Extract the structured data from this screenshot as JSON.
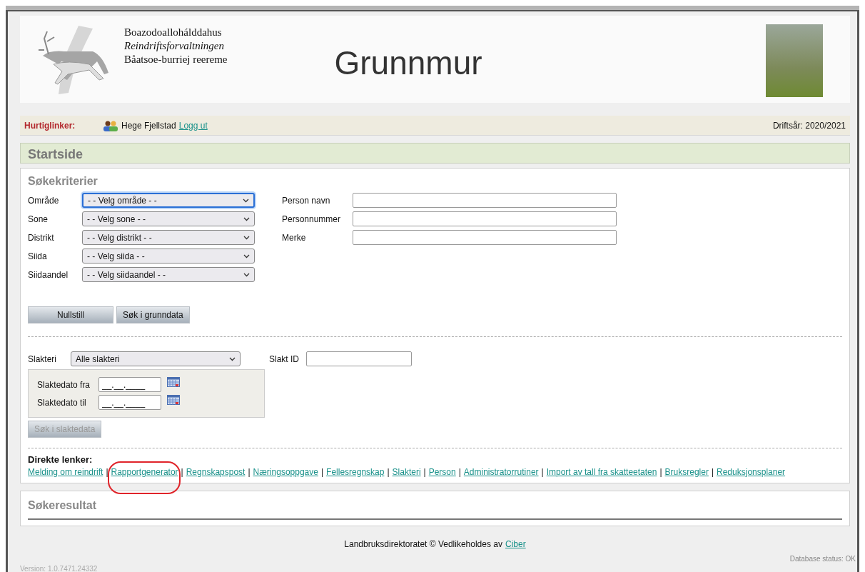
{
  "header": {
    "org_lines": [
      {
        "text": "Boazodoallohálddahus",
        "italic": false
      },
      {
        "text": "Reindriftsforvaltningen",
        "italic": true
      },
      {
        "text": "Båatsoe-burriej reereme",
        "italic": false
      }
    ],
    "title": "Grunnmur"
  },
  "quicklinks": {
    "label": "Hurtiglinker:",
    "user": "Hege Fjellstad",
    "logout": "Logg ut",
    "year": "Driftsår: 2020/2021"
  },
  "page_title": "Startside",
  "search": {
    "title": "Søkekriterier",
    "selects": [
      {
        "label": "Område",
        "value": "- - Velg område - -",
        "focused": true
      },
      {
        "label": "Sone",
        "value": "- - Velg sone - -",
        "focused": false
      },
      {
        "label": "Distrikt",
        "value": "- - Velg distrikt - -",
        "focused": false
      },
      {
        "label": "Siida",
        "value": "- - Velg siida - -",
        "focused": false
      },
      {
        "label": "Siidaandel",
        "value": "- - Velg siidaandel - -",
        "focused": false
      }
    ],
    "text_fields": [
      {
        "label": "Person navn"
      },
      {
        "label": "Personnummer"
      },
      {
        "label": "Merke"
      }
    ],
    "buttons": [
      {
        "label": "Nullstill"
      },
      {
        "label": "Søk i grunndata"
      }
    ]
  },
  "slakt": {
    "select": {
      "label": "Slakteri",
      "value": "Alle slakteri"
    },
    "id_field": {
      "label": "Slakt ID"
    },
    "dates": [
      {
        "label": "Slaktedato fra",
        "value": "__.__.____"
      },
      {
        "label": "Slaktedato til",
        "value": "__.__.____"
      }
    ],
    "button": {
      "label": "Søk i slaktedata",
      "disabled": true
    }
  },
  "direct_links": {
    "label": "Direkte lenker:",
    "separator": "|",
    "links": [
      {
        "label": "Melding om reindrift",
        "highlighted": false
      },
      {
        "label": "Rapportgenerator",
        "highlighted": true
      },
      {
        "label": "Regnskapspost",
        "highlighted": false
      },
      {
        "label": "Næringsoppgave",
        "highlighted": false
      },
      {
        "label": "Fellesregnskap",
        "highlighted": false
      },
      {
        "label": "Slakteri",
        "highlighted": false
      },
      {
        "label": "Person",
        "highlighted": false
      },
      {
        "label": "Administratorrutiner",
        "highlighted": false
      },
      {
        "label": "Import av tall fra skatteetaten",
        "highlighted": false
      },
      {
        "label": "Bruksregler",
        "highlighted": false
      },
      {
        "label": "Reduksjonsplaner",
        "highlighted": false
      }
    ]
  },
  "results": {
    "title": "Søkeresultat"
  },
  "footer": {
    "text": "Landbruksdirektoratet © Vedlikeholdes av",
    "link": "Ciber",
    "status": "Database status: OK",
    "version": "Version: 1.0.7471.24332"
  }
}
